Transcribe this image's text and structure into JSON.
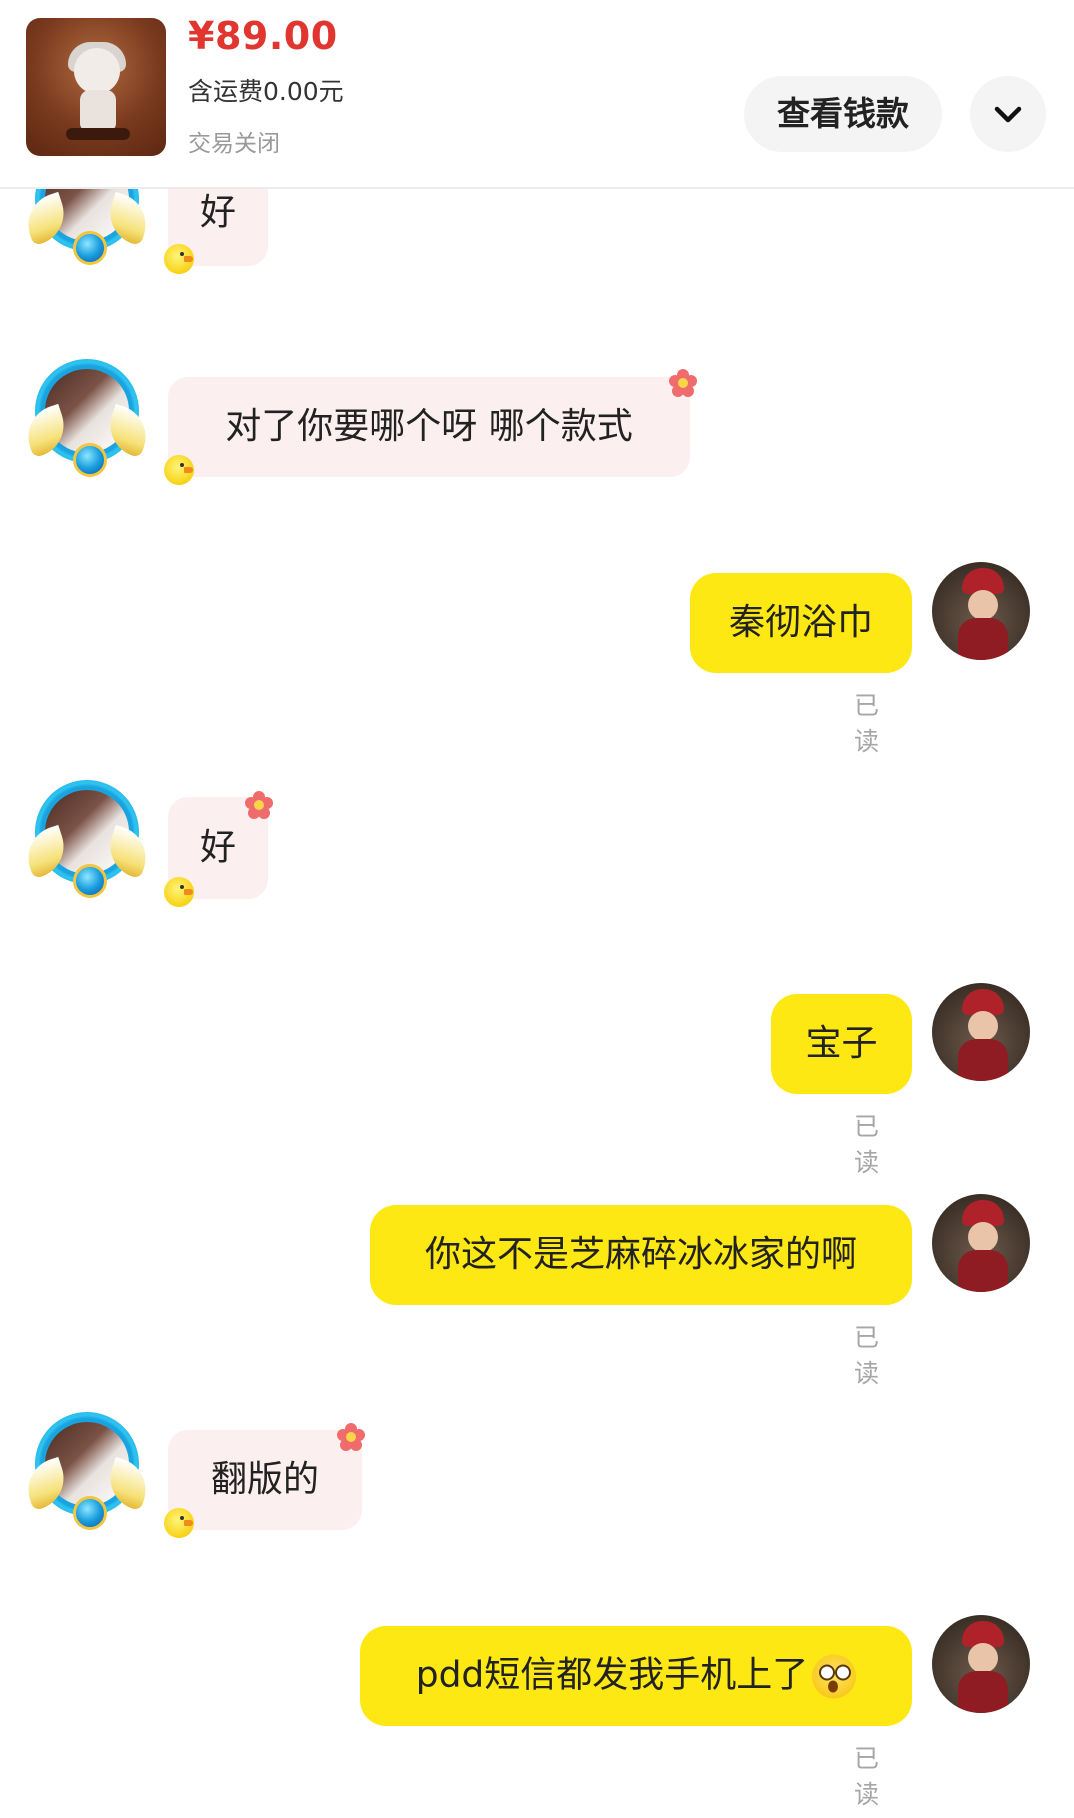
{
  "product": {
    "price": "¥89.00",
    "shipping": "含运费0.00元",
    "status": "交易关闭",
    "view_money_label": "查看钱款"
  },
  "icons": {
    "expand": "chevron-down-icon",
    "other_avatar": "avatar-angel-wings",
    "self_avatar": "avatar-red-hat-girl",
    "badge": "chick-icon",
    "decoration": "flower-icon",
    "emoji": "surprised-face-emoji"
  },
  "colors": {
    "price": "#e0362f",
    "self_bubble": "#fde814",
    "other_bubble": "#fbeff0",
    "read_text": "#a6a6a6"
  },
  "messages": [
    {
      "side": "other",
      "text": "好"
    },
    {
      "side": "other",
      "text": "对了你要哪个呀 哪个款式"
    },
    {
      "side": "self",
      "text": "秦彻浴巾",
      "status": "已读"
    },
    {
      "side": "other",
      "text": "好"
    },
    {
      "side": "self",
      "text": "宝子",
      "status": "已读"
    },
    {
      "side": "self",
      "text": "你这不是芝麻碎冰冰家的啊",
      "status": "已读"
    },
    {
      "side": "other",
      "text": "翻版的"
    },
    {
      "side": "self",
      "text": "pdd短信都发我手机上了",
      "status": "已读"
    }
  ]
}
